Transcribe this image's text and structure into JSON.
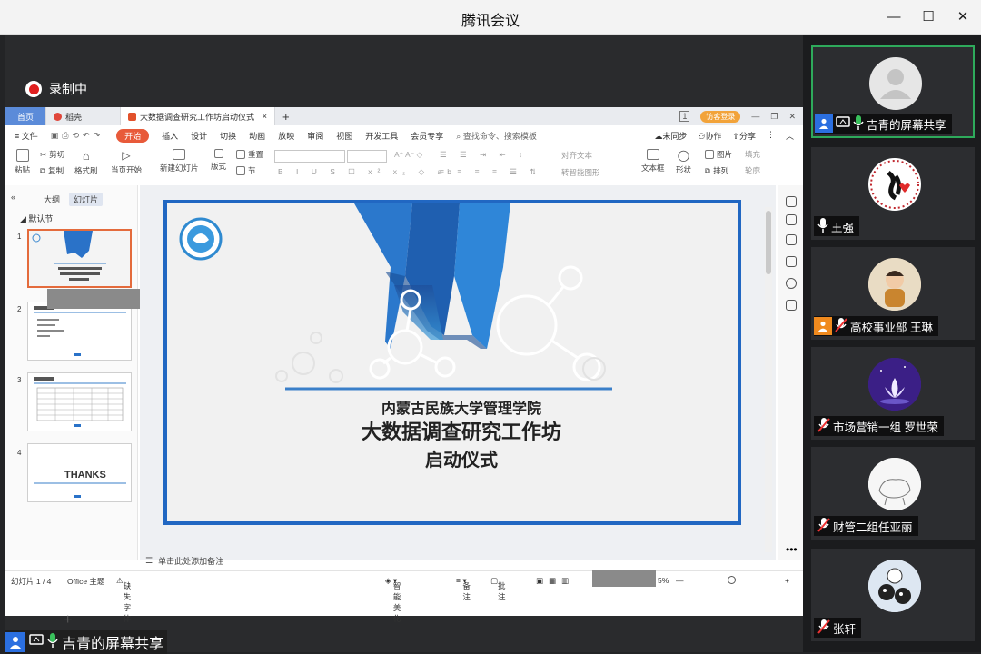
{
  "window": {
    "title": "腾讯会议"
  },
  "recording": {
    "label": "录制中"
  },
  "wps": {
    "tabs": {
      "home": "首页",
      "docer": "稻壳",
      "doc": "大数据调查研究工作坊启动仪式",
      "guest_login": "访客登录"
    },
    "menu": {
      "file": "文件",
      "items": [
        "开始",
        "插入",
        "设计",
        "切换",
        "动画",
        "放映",
        "审阅",
        "视图",
        "开发工具",
        "会员专享"
      ],
      "search": "查找命令、搜索模板",
      "unsynced": "未同步",
      "collab": "协作",
      "share": "分享"
    },
    "ribbon": {
      "paste": "粘贴",
      "cut": "剪切",
      "copy": "复制",
      "format_painter": "格式刷",
      "from_current": "当页开始",
      "new_slide": "新建幻灯片",
      "layout": "版式",
      "reset": "重置",
      "section": "节",
      "align_text": "对齐文本",
      "smart_shape": "转智能图形",
      "textbox": "文本框",
      "shape": "形状",
      "picture": "图片",
      "arrange": "排列",
      "fill": "填充",
      "outline": "轮廓"
    },
    "left_panel": {
      "outline_tab": "大纲",
      "slides_tab": "幻灯片",
      "section": "默认节",
      "nums": [
        "1",
        "2",
        "3",
        "4"
      ],
      "thanks": "THANKS"
    },
    "slide": {
      "line1": "内蒙古民族大学管理学院",
      "line2": "大数据调查研究工作坊",
      "line3": "启动仪式"
    },
    "notes_placeholder": "单击此处添加备注",
    "status": {
      "slide_count": "幻灯片 1 / 4",
      "theme": "Office 主题",
      "missing_font": "缺失字体",
      "beautify": "智能美化",
      "notes": "备注",
      "comment": "批注",
      "zoom": "5%"
    }
  },
  "share_footer": {
    "text": "吉青的屏幕共享"
  },
  "participants": [
    {
      "name": "吉青的屏幕共享",
      "mic": "on",
      "icon": "default-avatar-icon"
    },
    {
      "name": "王强",
      "mic": "on",
      "icon": "calligraphy-avatar-icon"
    },
    {
      "name": "高校事业部 王琳",
      "mic": "muted",
      "icon": "child-photo-avatar-icon"
    },
    {
      "name": "市场营销一组  罗世荣",
      "mic": "muted",
      "icon": "lotus-avatar-icon"
    },
    {
      "name": "财管二组任亚丽",
      "mic": "muted",
      "icon": "sketch-avatar-icon"
    },
    {
      "name": "张轩",
      "mic": "muted",
      "icon": "cartoon-avatar-icon"
    }
  ],
  "colors": {
    "accent_green": "#2eaa5b",
    "record_red": "#e02020",
    "wps_orange": "#e85a3a",
    "slide_blue": "#2167c2"
  }
}
